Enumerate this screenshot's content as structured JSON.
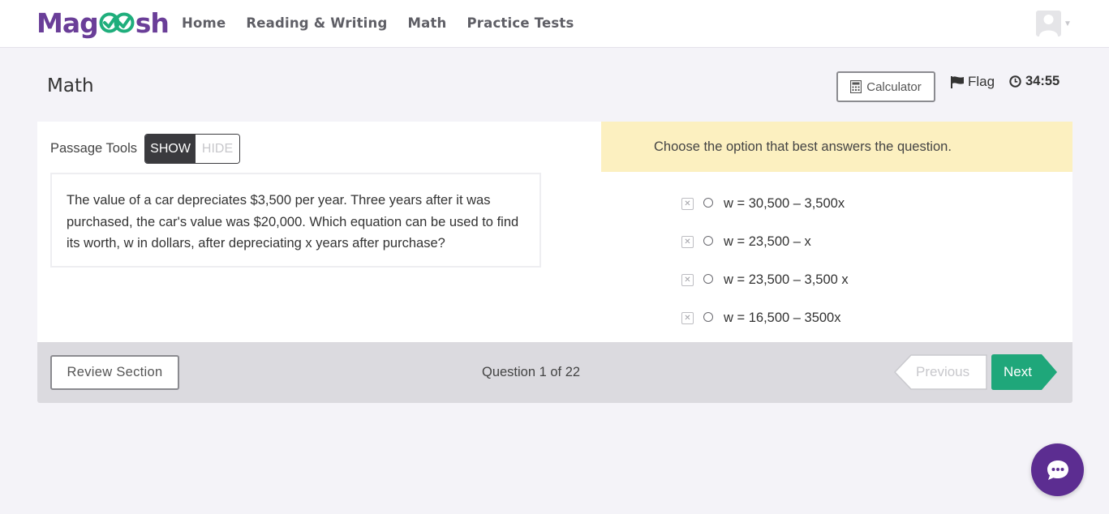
{
  "brand": {
    "logo_text_left": "Mag",
    "logo_text_right": "sh",
    "logo_color": "#6a3e98",
    "check_color": "#1fae7c"
  },
  "nav": [
    {
      "label": "Home"
    },
    {
      "label": "Reading & Writing"
    },
    {
      "label": "Math"
    },
    {
      "label": "Practice Tests"
    }
  ],
  "header": {
    "title": "Math",
    "calculator_label": "Calculator",
    "flag_label": "Flag",
    "timer": "34:55"
  },
  "passage_tools": {
    "label": "Passage Tools",
    "show_label": "SHOW",
    "hide_label": "HIDE",
    "selected": "SHOW"
  },
  "passage": {
    "text": "The value of a car depreciates $3,500 per year. Three years after it was purchased, the car's value was $20,000. Which equation can be used to find its worth, w in dollars, after depreciating x years after purchase?"
  },
  "question": {
    "instructions": "Choose the option that best answers the question.",
    "options": [
      {
        "label": "w = 30,500 – 3,500x"
      },
      {
        "label": "w = 23,500 – x"
      },
      {
        "label": "w = 23,500 – 3,500 x"
      },
      {
        "label": "w = 16,500 – 3500x"
      }
    ]
  },
  "footer": {
    "review_label": "Review Section",
    "question_count": "Question 1 of 22",
    "previous_label": "Previous",
    "next_label": "Next",
    "next_color": "#1fa77a"
  },
  "icons": {
    "calculator": "calculator-icon",
    "flag": "flag-icon",
    "timer": "clock-icon",
    "chat": "chat-bubble-icon",
    "eliminate": "eliminate-x-icon",
    "user": "user-avatar-icon"
  }
}
